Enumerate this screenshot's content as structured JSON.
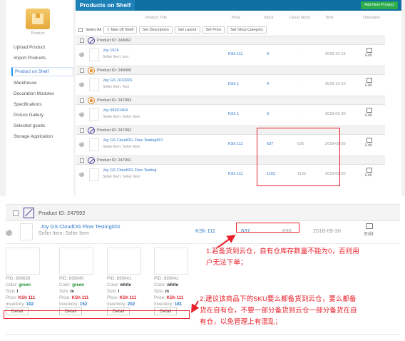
{
  "sidebar": {
    "product_label": "Product",
    "items": [
      {
        "label": "Upload Product"
      },
      {
        "label": "Import Products"
      },
      {
        "label": "Product on Shelf"
      },
      {
        "label": "Warehouse"
      },
      {
        "label": "Decoration Modules"
      },
      {
        "label": "Specifications"
      },
      {
        "label": "Picture Gallery"
      },
      {
        "label": "Selected goods"
      },
      {
        "label": "Storage Application"
      }
    ]
  },
  "header": {
    "tab_title": "Products on Shelf",
    "add_button": "Add New Product"
  },
  "columns": {
    "title": "Product Title",
    "price": "Price",
    "stock": "Stock",
    "cloud_stock": "Cloud Stock",
    "time": "Time",
    "operation": "Operation"
  },
  "toolbar": {
    "select_all": "Select All",
    "take_off": "Take off Shelf",
    "take_off_prefix": "1",
    "set_description": "Set Description",
    "set_layout": "Set Layout",
    "set_price": "Set Price",
    "set_category": "Set Shop Category"
  },
  "products": [
    {
      "id_label": "Product ID: 248062",
      "icon": "ban",
      "title": "Joy 1016",
      "seller": "Seller Item: test",
      "price": "KSh 111",
      "stock": "0",
      "cloud": "-",
      "time": "2018-10-16",
      "op": "Edit"
    },
    {
      "id_label": "Product ID: 248006",
      "icon": "ksa",
      "title": "Joy GS 1010001",
      "seller": "Seller Item: Test",
      "price": "KSh 1",
      "stock": "4",
      "cloud": "-",
      "time": "2018-10-10",
      "op": "Edit"
    },
    {
      "id_label": "Product ID: 247993",
      "icon": "ksa",
      "title": "Joy 09301404",
      "seller": "Seller Item: Seller Item",
      "price": "KSh 1",
      "stock": "0",
      "cloud": "-",
      "time": "2018-09-30",
      "op": "Edit"
    },
    {
      "id_label": "Product ID: 247992",
      "icon": "ban",
      "title": "Joy GS CloudDG Flow Testing001",
      "seller": "Seller Item: Seller Item",
      "price": "KSh 111",
      "stock": "637",
      "cloud": "636",
      "time": "2018-09-30",
      "op": "Edit"
    },
    {
      "id_label": "Product ID: 247991",
      "icon": "ban",
      "title": "Joy GS CloudDG Flow Testing",
      "seller": "Seller Item: Seller Item",
      "price": "KSh 111",
      "stock": "1103",
      "cloud": "1103",
      "time": "2018-09-30",
      "op": "Edit"
    }
  ],
  "zoom": {
    "id_label": "Product ID: 247992",
    "title": "Joy GS CloudDG Flow Testing001",
    "seller": "Seller Item: Seller Item",
    "price": "KSh 111",
    "stock": "637",
    "cloud": "636",
    "time": "2018-09-30",
    "op": "Edit",
    "skus": [
      {
        "pid": "PID: 899639",
        "color_k": "Color: ",
        "color_v": "green",
        "size_k": "Size: ",
        "size_v": "l",
        "price_k": "Price: ",
        "price_v": "KSh 111",
        "inv_k": "Inventory: ",
        "inv_v": "102",
        "detail": "Detail"
      },
      {
        "pid": "PID: 899640",
        "color_k": "Color: ",
        "color_v": "green",
        "size_k": "Size: ",
        "size_v": "m",
        "price_k": "Price: ",
        "price_v": "KSh 111",
        "inv_k": "Inventory: ",
        "inv_v": "152",
        "detail": "Detail"
      },
      {
        "pid": "PID: 899641",
        "color_k": "Color: ",
        "color_v": "white",
        "size_k": "Size: ",
        "size_v": "l",
        "price_k": "Price: ",
        "price_v": "KSh 111",
        "inv_k": "Inventory: ",
        "inv_v": "202",
        "detail": "Detail"
      },
      {
        "pid": "PID: 899642",
        "color_k": "Color: ",
        "color_v": "white",
        "size_k": "Size: ",
        "size_v": "m",
        "price_k": "Price: ",
        "price_v": "KSh 111",
        "inv_k": "Inventory: ",
        "inv_v": "181",
        "detail": "Detail"
      }
    ]
  },
  "annotations": {
    "note1_line1": "1.若备货到云仓，自有仓库存数量不能为0，否则用",
    "note1_line2": "户无法下单；",
    "note2_line1": "2.建议该商品下的SKU要么都备货到云仓，要么都备",
    "note2_line2": "货在自有仓，不要一部分备货到云仓一部分备货在自",
    "note2_line3": "有仓，以免管理上有混乱；"
  },
  "colors": {
    "header_blue": "#0f6ea3",
    "add_green": "#2cab4a",
    "link_blue": "#2f77c9",
    "annotation_red": "#e8202b"
  }
}
